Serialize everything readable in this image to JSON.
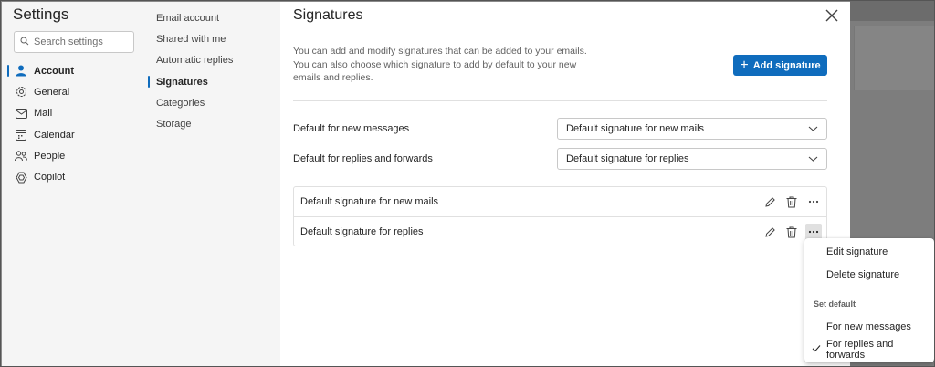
{
  "settings": {
    "title": "Settings",
    "search_placeholder": "Search settings"
  },
  "nav": {
    "items": [
      {
        "label": "Account",
        "icon": "person-icon"
      },
      {
        "label": "General",
        "icon": "gear-icon"
      },
      {
        "label": "Mail",
        "icon": "mail-icon"
      },
      {
        "label": "Calendar",
        "icon": "calendar-icon"
      },
      {
        "label": "People",
        "icon": "people-icon"
      },
      {
        "label": "Copilot",
        "icon": "copilot-icon"
      }
    ],
    "active": "Account"
  },
  "subnav": {
    "items": [
      "Email account",
      "Shared with me",
      "Automatic replies",
      "Signatures",
      "Categories",
      "Storage"
    ],
    "active": "Signatures"
  },
  "main": {
    "title": "Signatures",
    "intro": "You can add and modify signatures that can be added to your emails. You can also choose which signature to add by default to your new emails and replies.",
    "add_button": "Add signature",
    "defaults": [
      {
        "label": "Default for new messages",
        "value": "Default signature for new mails"
      },
      {
        "label": "Default for replies and forwards",
        "value": "Default signature for replies"
      }
    ],
    "signatures": [
      "Default signature for new mails",
      "Default signature for replies"
    ]
  },
  "menu": {
    "edit": "Edit signature",
    "delete": "Delete signature",
    "section_header": "Set default",
    "for_new": "For new messages",
    "for_replies": "For replies and forwards",
    "checked": "For replies and forwards"
  },
  "colors": {
    "accent": "#0f6cbd",
    "nav_bg": "#f5f5f5",
    "overlay": "#8a8a8a"
  }
}
